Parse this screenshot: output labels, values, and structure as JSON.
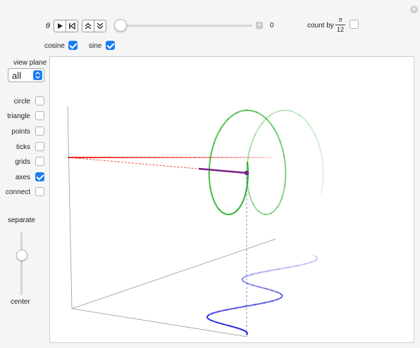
{
  "controls": {
    "theta_label": "θ",
    "theta_value": "0",
    "count_by_label": "count by",
    "count_by_numerator": "π",
    "count_by_denominator": "12",
    "count_by_checked": false,
    "cosine_label": "cosine",
    "cosine_checked": true,
    "sine_label": "sine",
    "sine_checked": true,
    "slider_fraction": 0.0
  },
  "sidebar": {
    "view_plane_label": "view plane",
    "view_plane_value": "all",
    "options": [
      {
        "label": "circle",
        "checked": false
      },
      {
        "label": "triangle",
        "checked": false
      },
      {
        "label": "points",
        "checked": false
      },
      {
        "label": "ticks",
        "checked": false
      },
      {
        "label": "grids",
        "checked": false
      },
      {
        "label": "axes",
        "checked": true
      },
      {
        "label": "connect",
        "checked": false
      }
    ],
    "separate_label": "separate",
    "center_label": "center",
    "separate_fraction": 0.28
  },
  "colors": {
    "accent": "#1d7cf2",
    "cosine": "#e8231f",
    "circle": "#1fae1f",
    "sine": "#1818d6",
    "radius": "#7a1f86"
  }
}
